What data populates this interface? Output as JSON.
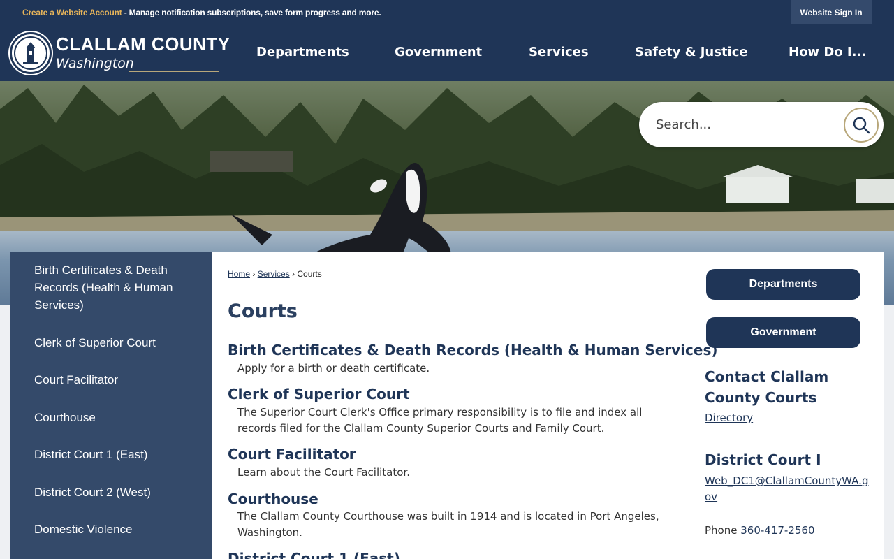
{
  "topbar": {
    "create_account_link": "Create a Website Account",
    "create_account_msg": " - Manage notification subscriptions, save form progress and more.",
    "signin_label": "Website Sign In"
  },
  "header": {
    "logo_name": "CLALLAM COUNTY",
    "logo_sub": "Washington",
    "nav": [
      "Departments",
      "Government",
      "Services",
      "Safety & Justice",
      "How Do I..."
    ]
  },
  "search": {
    "placeholder": "Search..."
  },
  "sidebar": {
    "items": [
      "Birth Certificates & Death Records (Health & Human Services)",
      "Clerk of Superior Court",
      "Court Facilitator",
      "Courthouse",
      "District Court 1 (East)",
      "District Court 2 (West)",
      "Domestic Violence"
    ]
  },
  "breadcrumb": {
    "home": "Home",
    "sep1": " › ",
    "services": "Services",
    "sep2": " › ",
    "current": "Courts"
  },
  "page_title": "Courts",
  "entries": [
    {
      "title": "Birth Certificates & Death Records (Health & Human Services)",
      "desc": "Apply for a birth or death certificate."
    },
    {
      "title": "Clerk of Superior Court",
      "desc": "The Superior Court Clerk's Office primary responsibility is to file and index all records filed for the Clallam County Superior Courts and Family Court."
    },
    {
      "title": "Court Facilitator",
      "desc": "Learn about the Court Facilitator."
    },
    {
      "title": "Courthouse",
      "desc": "The Clallam County Courthouse was built in 1914 and is located in Port Angeles, Washington."
    },
    {
      "title": "District Court 1 (East)",
      "desc": ""
    }
  ],
  "right": {
    "buttons": [
      "Departments",
      "Government"
    ],
    "contact_heading": "Contact Clallam County Courts",
    "directory_link": "Directory",
    "district_heading": "District Court I",
    "email": "Web_DC1@ClallamCountyWA.gov",
    "phone_label": "Phone ",
    "phone": "360-417-2560"
  },
  "colors": {
    "navy": "#1f3557",
    "gold": "#e6b45a",
    "sidebar": "#344a6a"
  }
}
